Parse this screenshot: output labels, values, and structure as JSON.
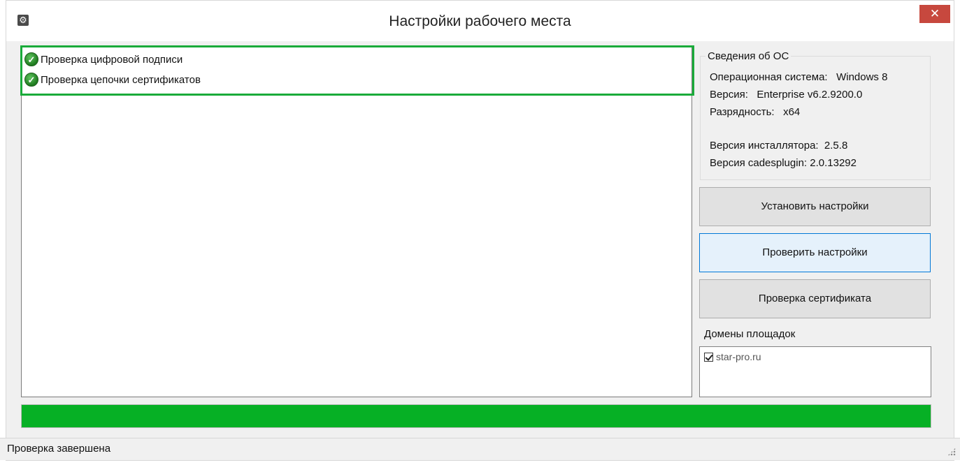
{
  "window": {
    "title": "Настройки рабочего места",
    "icon": "gear-icon",
    "close_label": "✕"
  },
  "log": {
    "items": [
      {
        "label": "Проверка цифровой подписи",
        "icon": "check-badge-icon",
        "status": "success"
      },
      {
        "label": "Проверка цепочки сертификатов",
        "icon": "check-badge-icon",
        "status": "success"
      }
    ],
    "highlight_color": "#1aab3a"
  },
  "os_info": {
    "legend": "Сведения об ОС",
    "os_line": "Операционная система:   Windows 8",
    "version_line": "Версия:   Enterprise v6.2.9200.0",
    "bitness_line": "Разрядность:   x64",
    "installer_line": "Версия инсталлятора:  2.5.8",
    "cadesplugin_line": "Версия cadesplugin: 2.0.13292"
  },
  "buttons": {
    "install": "Установить настройки",
    "check": "Проверить настройки",
    "cert_check": "Проверка сертификата"
  },
  "domains": {
    "label": "Домены площадок",
    "items": [
      {
        "label": "star-pro.ru",
        "checked": true
      }
    ]
  },
  "progress": {
    "percent": 100,
    "color": "#06b025"
  },
  "status": {
    "text": "Проверка завершена"
  }
}
